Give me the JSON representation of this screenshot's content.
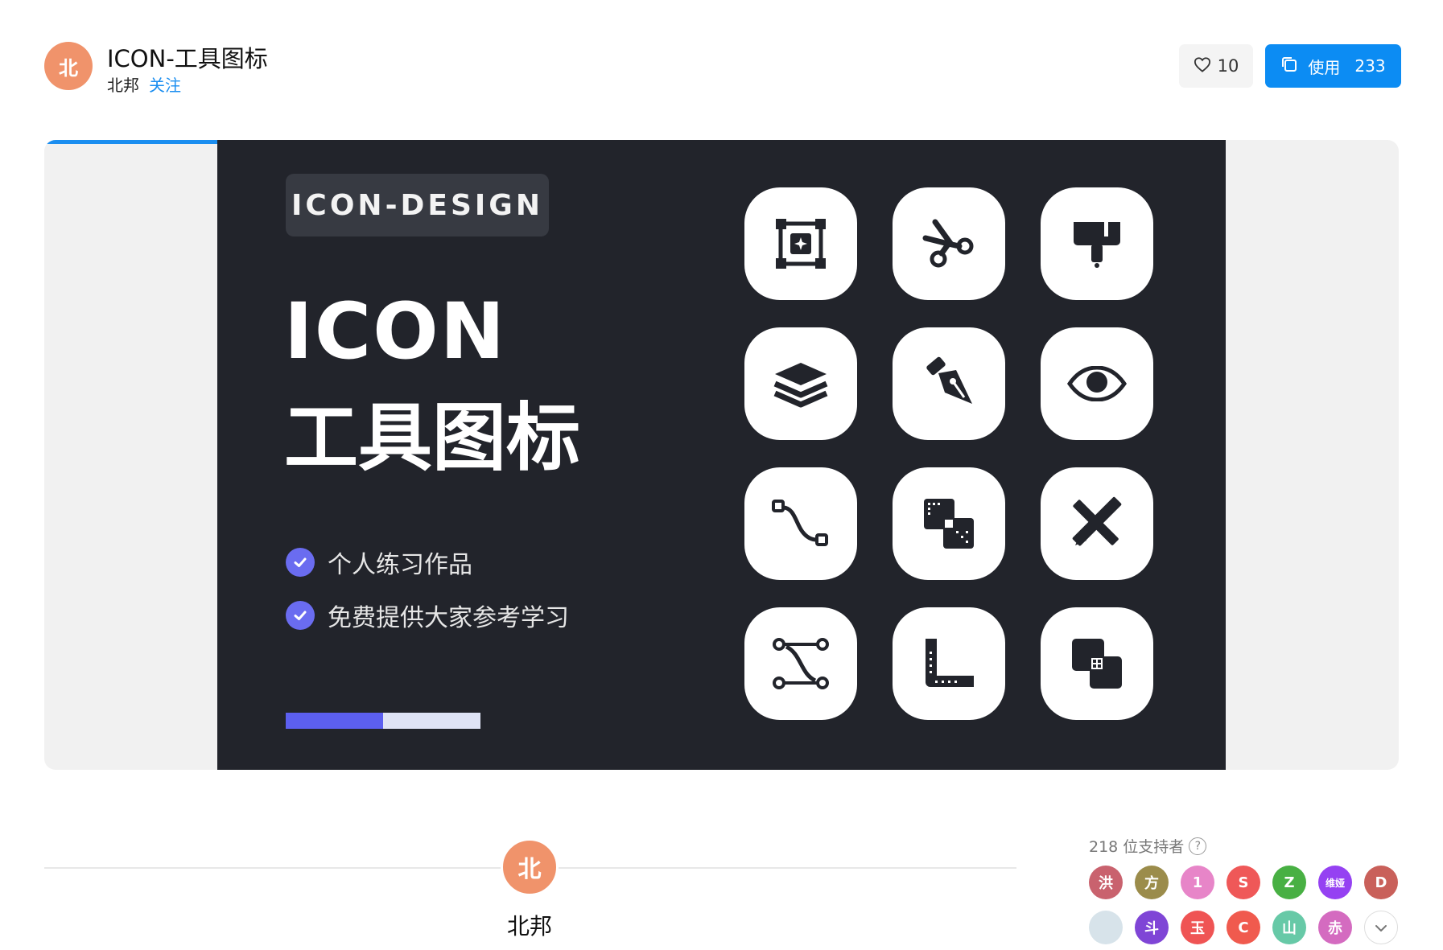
{
  "header": {
    "avatar_text": "北",
    "title": "ICON-工具图标",
    "author": "北邦",
    "follow_label": "关注",
    "like_count": "10",
    "use_label": "使用",
    "use_count": "233"
  },
  "banner": {
    "progress_fraction": 0.18,
    "tag": "ICON-DESIGN",
    "headline_1": "ICON",
    "headline_2": "工具图标",
    "bullets": [
      "个人练习作品",
      "免费提供大家参考学习"
    ],
    "bar_fraction": 0.5,
    "icons": [
      "frame-icon",
      "scissors-icon",
      "paint-brush-icon",
      "layers-icon",
      "pen-tool-icon",
      "eye-icon",
      "path-curve-icon",
      "pattern-overlap-icon",
      "ruler-pencil-icon",
      "bezier-icon",
      "corner-radius-icon",
      "boolean-union-icon"
    ]
  },
  "profile": {
    "avatar_text": "北",
    "name": "北邦"
  },
  "supporters": {
    "count_label": "218 位支持者",
    "help_symbol": "?",
    "avatars": [
      {
        "text": "洪",
        "color": "#c9626e"
      },
      {
        "text": "方",
        "color": "#9b8c4b"
      },
      {
        "text": "1",
        "color": "#e785c8"
      },
      {
        "text": "S",
        "color": "#ef5858"
      },
      {
        "text": "Z",
        "color": "#48b043"
      },
      {
        "text": "维娅",
        "color": "#9541f2"
      },
      {
        "text": "D",
        "color": "#c9605a"
      },
      {
        "text": "",
        "color": "#d7e3ea"
      },
      {
        "text": "斗",
        "color": "#7f45d6"
      },
      {
        "text": "玉",
        "color": "#ef5454"
      },
      {
        "text": "C",
        "color": "#f05a4e"
      },
      {
        "text": "山",
        "color": "#67c9a7"
      },
      {
        "text": "赤",
        "color": "#d46bc0"
      }
    ],
    "more_symbol": "⌄"
  }
}
